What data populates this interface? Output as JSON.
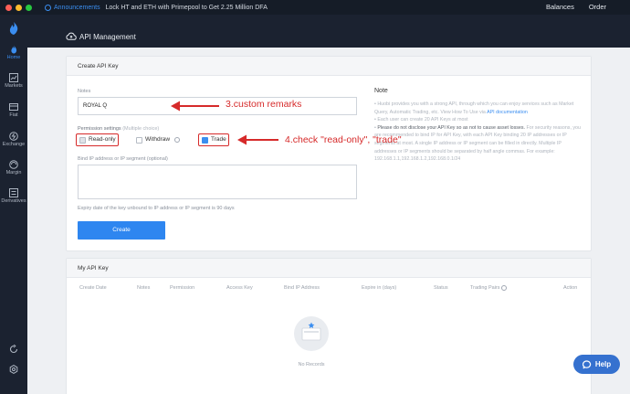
{
  "topbar": {
    "announcement_label": "Announcements",
    "announcement_text": "Lock HT and ETH with Primepool to Get 2.25 Million DFA",
    "balances": "Balances",
    "order": "Order",
    "dots": [
      "#ff5f57",
      "#febc2e",
      "#28c840"
    ]
  },
  "sidebar": {
    "items": [
      {
        "label": "Home",
        "icon": "home-icon"
      },
      {
        "label": "Markets",
        "icon": "markets-icon"
      },
      {
        "label": "Fiat",
        "icon": "fiat-icon"
      },
      {
        "label": "Exchange",
        "icon": "exchange-icon"
      },
      {
        "label": "Margin",
        "icon": "margin-icon"
      },
      {
        "label": "Derivatives",
        "icon": "derivatives-icon"
      }
    ]
  },
  "page": {
    "title": "API Management"
  },
  "create": {
    "header": "Create API Key",
    "notes_label": "Notes",
    "notes_value": "ROYAL Q",
    "perm_label": "Permission settings",
    "perm_hint": "(Multiple choice)",
    "perm": {
      "read_only": "Read-only",
      "withdraw": "Withdraw",
      "trade": "Trade"
    },
    "bind_label": "Bind IP address or IP segment (optional)",
    "expiry_hint": "Expiry date of the key unbound to IP address or IP segment is 90 days",
    "create_button": "Create"
  },
  "note": {
    "title": "Note",
    "line1": "Huobi provides you with a strong API, through which you can enjoy services such as Market Query, Automatic Trading, etc. View How To Use via",
    "line1_link": "API documentation",
    "line2": "Each user can create 20 API Keys at most",
    "line3_dark": "Please do not disclose your API Key so as not to cause asset losses.",
    "line3": "For security reasons, you are recommended to bind IP for API Key, with each API Key binding 20 IP addresses or IP segments at most. A single IP address or IP segment can be filled in directly. Multiple IP addresses or IP segments should be separated by half angle commas. For example: 192.168.1.1,192.168.1.2,192.168.0.1/24"
  },
  "annotations": {
    "remarks": "3.custom remarks",
    "check": "4.check \"read-only\", \"trade\""
  },
  "my_keys": {
    "header": "My API Key",
    "columns": [
      "Create Date",
      "Notes",
      "Permission",
      "Access Key",
      "Bind IP Address",
      "Expire in (days)",
      "Status",
      "Trading Pairs",
      "Action"
    ],
    "empty": "No Records"
  },
  "help": {
    "label": "Help"
  },
  "colors": {
    "accent": "#2e86f0",
    "annotation": "#d62a2a",
    "dark_bg": "#1b2230"
  }
}
